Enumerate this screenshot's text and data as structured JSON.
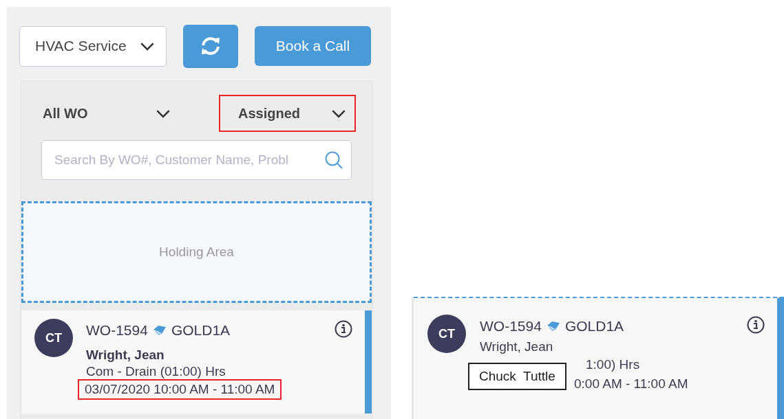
{
  "toolbar": {
    "service_select": "HVAC Service",
    "book_button": "Book a Call"
  },
  "filters": [
    {
      "label": "All WO",
      "highlighted": false
    },
    {
      "label": "Assigned",
      "highlighted": true
    }
  ],
  "search": {
    "placeholder": "Search By WO#, Customer Name, Probl"
  },
  "holding_area": {
    "label": "Holding Area"
  },
  "cards": [
    {
      "kind": "full",
      "avatar": "CT",
      "wo": "WO-1594",
      "code": "GOLD1A",
      "customer": "Wright, Jean",
      "problem": "Com - Drain (01:00) Hrs",
      "schedule": "03/07/2020 10:00 AM - 11:00 AM",
      "schedule_highlighted": true
    },
    {
      "kind": "hover",
      "avatar": "CT",
      "wo": "WO-1594",
      "code": "GOLD1A",
      "customer": "Wright, Jean",
      "problem": "1:00) Hrs",
      "schedule": "0:00 AM - 11:00 AM",
      "schedule_highlighted": false,
      "tooltip": "Chuck  Tuttle"
    }
  ]
}
